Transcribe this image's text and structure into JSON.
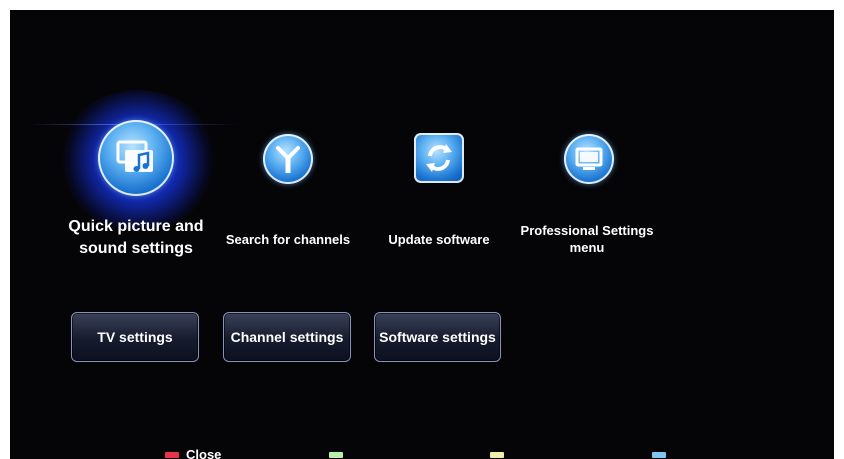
{
  "menu": {
    "tiles": [
      {
        "label": "Quick picture and sound settings",
        "icon": "picture-sound-icon"
      },
      {
        "label": "Search for channels",
        "icon": "antenna-icon"
      },
      {
        "label": "Update software",
        "icon": "refresh-icon"
      },
      {
        "label": "Professional Settings menu",
        "icon": "monitor-icon"
      }
    ],
    "selected_index": 0
  },
  "buttons": {
    "tv_settings": "TV settings",
    "channel_settings": "Channel settings",
    "software_settings": "Software settings"
  },
  "color_keys": {
    "red_label": "Close",
    "colors": {
      "red": "#e8344a",
      "green": "#b8f0a8",
      "yellow": "#f2f0a8",
      "blue": "#7cc6f0"
    }
  },
  "colors": {
    "background": "#050507",
    "accent_glow": "#2f5bff"
  }
}
